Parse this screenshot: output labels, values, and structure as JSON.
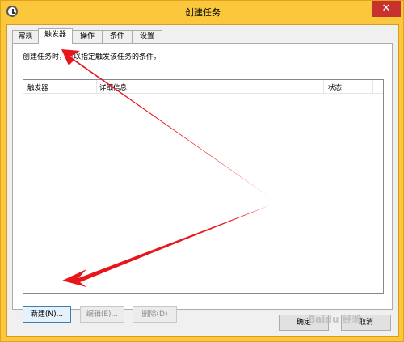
{
  "window": {
    "title": "创建任务",
    "close_glyph": "✕"
  },
  "tabs": [
    {
      "label": "常规"
    },
    {
      "label": "触发器",
      "active": true
    },
    {
      "label": "操作"
    },
    {
      "label": "条件"
    },
    {
      "label": "设置"
    }
  ],
  "panel": {
    "description": "创建任务时，可以指定触发该任务的条件。",
    "columns": [
      "触发器",
      "详细信息",
      "状态"
    ]
  },
  "buttons": {
    "new": "新建(N)...",
    "edit": "编辑(E)...",
    "delete": "删除(D)",
    "ok": "确定",
    "cancel": "取消"
  },
  "colors": {
    "frame": "#fbc73c",
    "close": "#c7322f",
    "annotation_arrow": "#e8151b"
  },
  "watermark": "Baidu 经验"
}
